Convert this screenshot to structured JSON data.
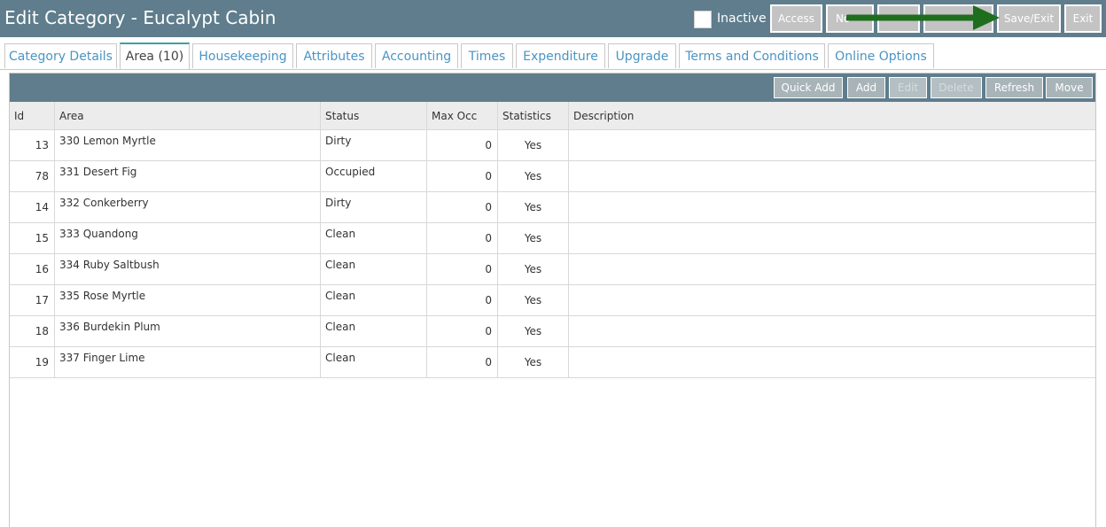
{
  "header": {
    "title": "Edit Category - Eucalypt Cabin",
    "inactive_label": "Inactive",
    "buttons": {
      "access": "Access",
      "notes": "No",
      "blank1": "",
      "blank2": "",
      "save_exit": "Save/Exit",
      "exit": "Exit"
    },
    "arrow_color": "#1e6e1e"
  },
  "tabs": [
    {
      "label": "Category Details"
    },
    {
      "label": "Area (10)"
    },
    {
      "label": "Housekeeping"
    },
    {
      "label": "Attributes"
    },
    {
      "label": "Accounting"
    },
    {
      "label": "Times"
    },
    {
      "label": "Expenditure"
    },
    {
      "label": "Upgrade"
    },
    {
      "label": "Terms and Conditions"
    },
    {
      "label": "Online Options"
    }
  ],
  "grid": {
    "buttons": {
      "quick_add": "Quick Add",
      "add": "Add",
      "edit": "Edit",
      "delete": "Delete",
      "refresh": "Refresh",
      "move": "Move"
    },
    "columns": [
      "Id",
      "Area",
      "Status",
      "Max Occ",
      "Statistics",
      "Description"
    ],
    "rows": [
      {
        "id": "13",
        "area": "330 Lemon Myrtle",
        "status": "Dirty",
        "max_occ": "0",
        "statistics": "Yes",
        "description": ""
      },
      {
        "id": "78",
        "area": "331 Desert Fig",
        "status": "Occupied",
        "max_occ": "0",
        "statistics": "Yes",
        "description": ""
      },
      {
        "id": "14",
        "area": "332 Conkerberry",
        "status": "Dirty",
        "max_occ": "0",
        "statistics": "Yes",
        "description": ""
      },
      {
        "id": "15",
        "area": "333 Quandong",
        "status": "Clean",
        "max_occ": "0",
        "statistics": "Yes",
        "description": ""
      },
      {
        "id": "16",
        "area": "334 Ruby Saltbush",
        "status": "Clean",
        "max_occ": "0",
        "statistics": "Yes",
        "description": ""
      },
      {
        "id": "17",
        "area": "335 Rose Myrtle",
        "status": "Clean",
        "max_occ": "0",
        "statistics": "Yes",
        "description": ""
      },
      {
        "id": "18",
        "area": "336 Burdekin Plum",
        "status": "Clean",
        "max_occ": "0",
        "statistics": "Yes",
        "description": ""
      },
      {
        "id": "19",
        "area": "337 Finger Lime",
        "status": "Clean",
        "max_occ": "0",
        "statistics": "Yes",
        "description": ""
      }
    ]
  }
}
